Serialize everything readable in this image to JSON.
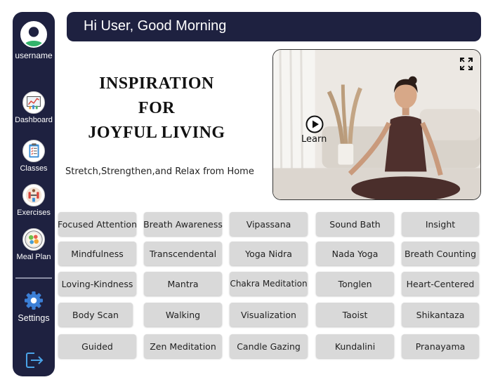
{
  "user": {
    "name": "username"
  },
  "header": {
    "greeting": "Hi User, Good Morning"
  },
  "sidebar": {
    "items": [
      {
        "label": "Dashboard",
        "icon": "dashboard-icon"
      },
      {
        "label": "Classes",
        "icon": "classes-icon"
      },
      {
        "label": "Exercises",
        "icon": "exercises-icon"
      },
      {
        "label": "Meal Plan",
        "icon": "meal-plan-icon"
      }
    ],
    "settings_label": "Settings",
    "logout_icon": "logout-icon"
  },
  "hero": {
    "title_lines": [
      "INSPIRATION",
      "FOR",
      "JOYFUL LIVING"
    ],
    "subtitle": "Stretch,Strengthen,and Relax from Home"
  },
  "video": {
    "play_label": "Learn",
    "play_icon": "play-icon",
    "expand_icon": "expand-icon"
  },
  "tags": [
    [
      "Focused Attention",
      "Breath Awareness",
      "Vipassana",
      "Sound Bath",
      "Insight"
    ],
    [
      "Mindfulness",
      "Transcendental",
      "Yoga Nidra",
      "Nada Yoga",
      "Breath Counting"
    ],
    [
      "Loving-Kindness",
      "Mantra",
      "Chakra Meditation",
      "Tonglen",
      "Heart-Centered"
    ],
    [
      "Body Scan",
      "Walking",
      "Visualization",
      "Taoist",
      "Shikantaza"
    ],
    [
      "Guided",
      "Zen Meditation",
      "Candle Gazing",
      "Kundalini",
      "Pranayama"
    ]
  ],
  "colors": {
    "navy": "#1e2140",
    "tag_bg": "#d9d9d9",
    "settings_blue": "#3b7fd6"
  }
}
